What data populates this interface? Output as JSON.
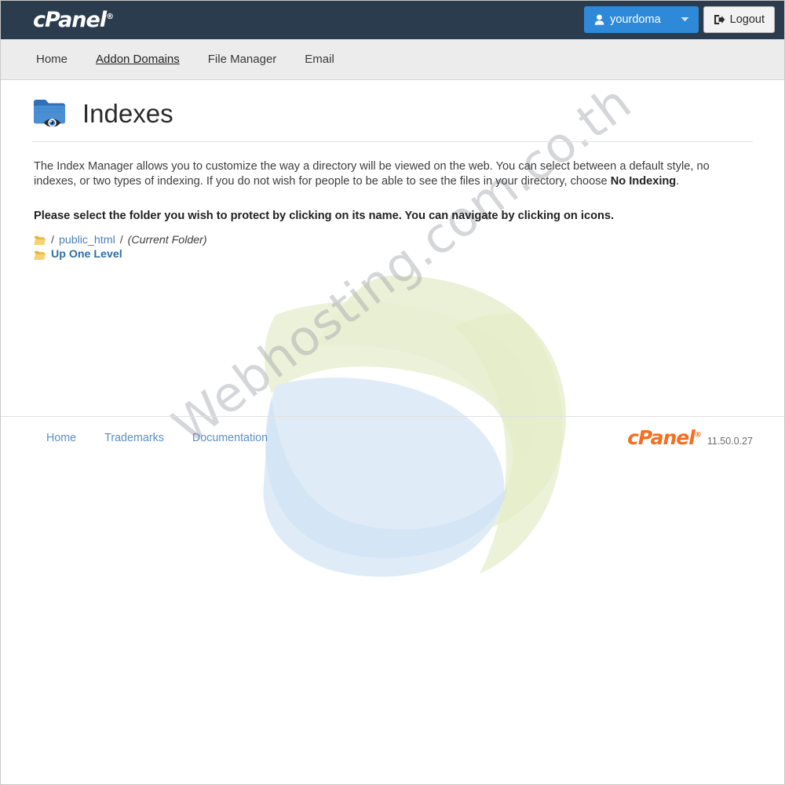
{
  "header": {
    "brand": "cPanel",
    "brand_tm": "®",
    "user_button": {
      "label": "yourdoma",
      "icon": "user-icon",
      "caret": "▼"
    },
    "logout_button": {
      "label": "Logout",
      "icon": "logout-icon"
    },
    "accent_color": "#2e8ad8",
    "bar_color": "#2b3c4e"
  },
  "nav": {
    "items": [
      {
        "label": "Home",
        "active": false
      },
      {
        "label": "Addon Domains",
        "active": true
      },
      {
        "label": "File Manager",
        "active": false
      },
      {
        "label": "Email",
        "active": false
      }
    ]
  },
  "main": {
    "title": "Indexes",
    "title_icon": "folder-eye-icon",
    "description_part1": "The Index Manager allows you to customize the way a directory will be viewed on the web. You can select between a default style, no indexes, or two types of indexing. If you do not wish for people to be able to see the files in your directory, choose ",
    "description_bold": "No Indexing",
    "description_part2": ".",
    "instruction": "Please select the folder you wish to protect by clicking on its name. You can navigate by clicking on icons.",
    "breadcrumb": {
      "icon": "folder-open-icon",
      "root_sep": "/",
      "folder_name": "public_html",
      "trailing_sep": "/",
      "current_label": "(Current Folder)"
    },
    "up_one_level": {
      "icon": "folder-open-icon",
      "label": "Up One Level"
    }
  },
  "footer": {
    "links": [
      {
        "label": "Home"
      },
      {
        "label": "Trademarks"
      },
      {
        "label": "Documentation"
      }
    ],
    "brand": "cPanel",
    "brand_tm": "®",
    "version": "11.50.0.27",
    "brand_color": "#f36f21"
  },
  "watermark": {
    "text": "Webhosting.com.co.th"
  }
}
